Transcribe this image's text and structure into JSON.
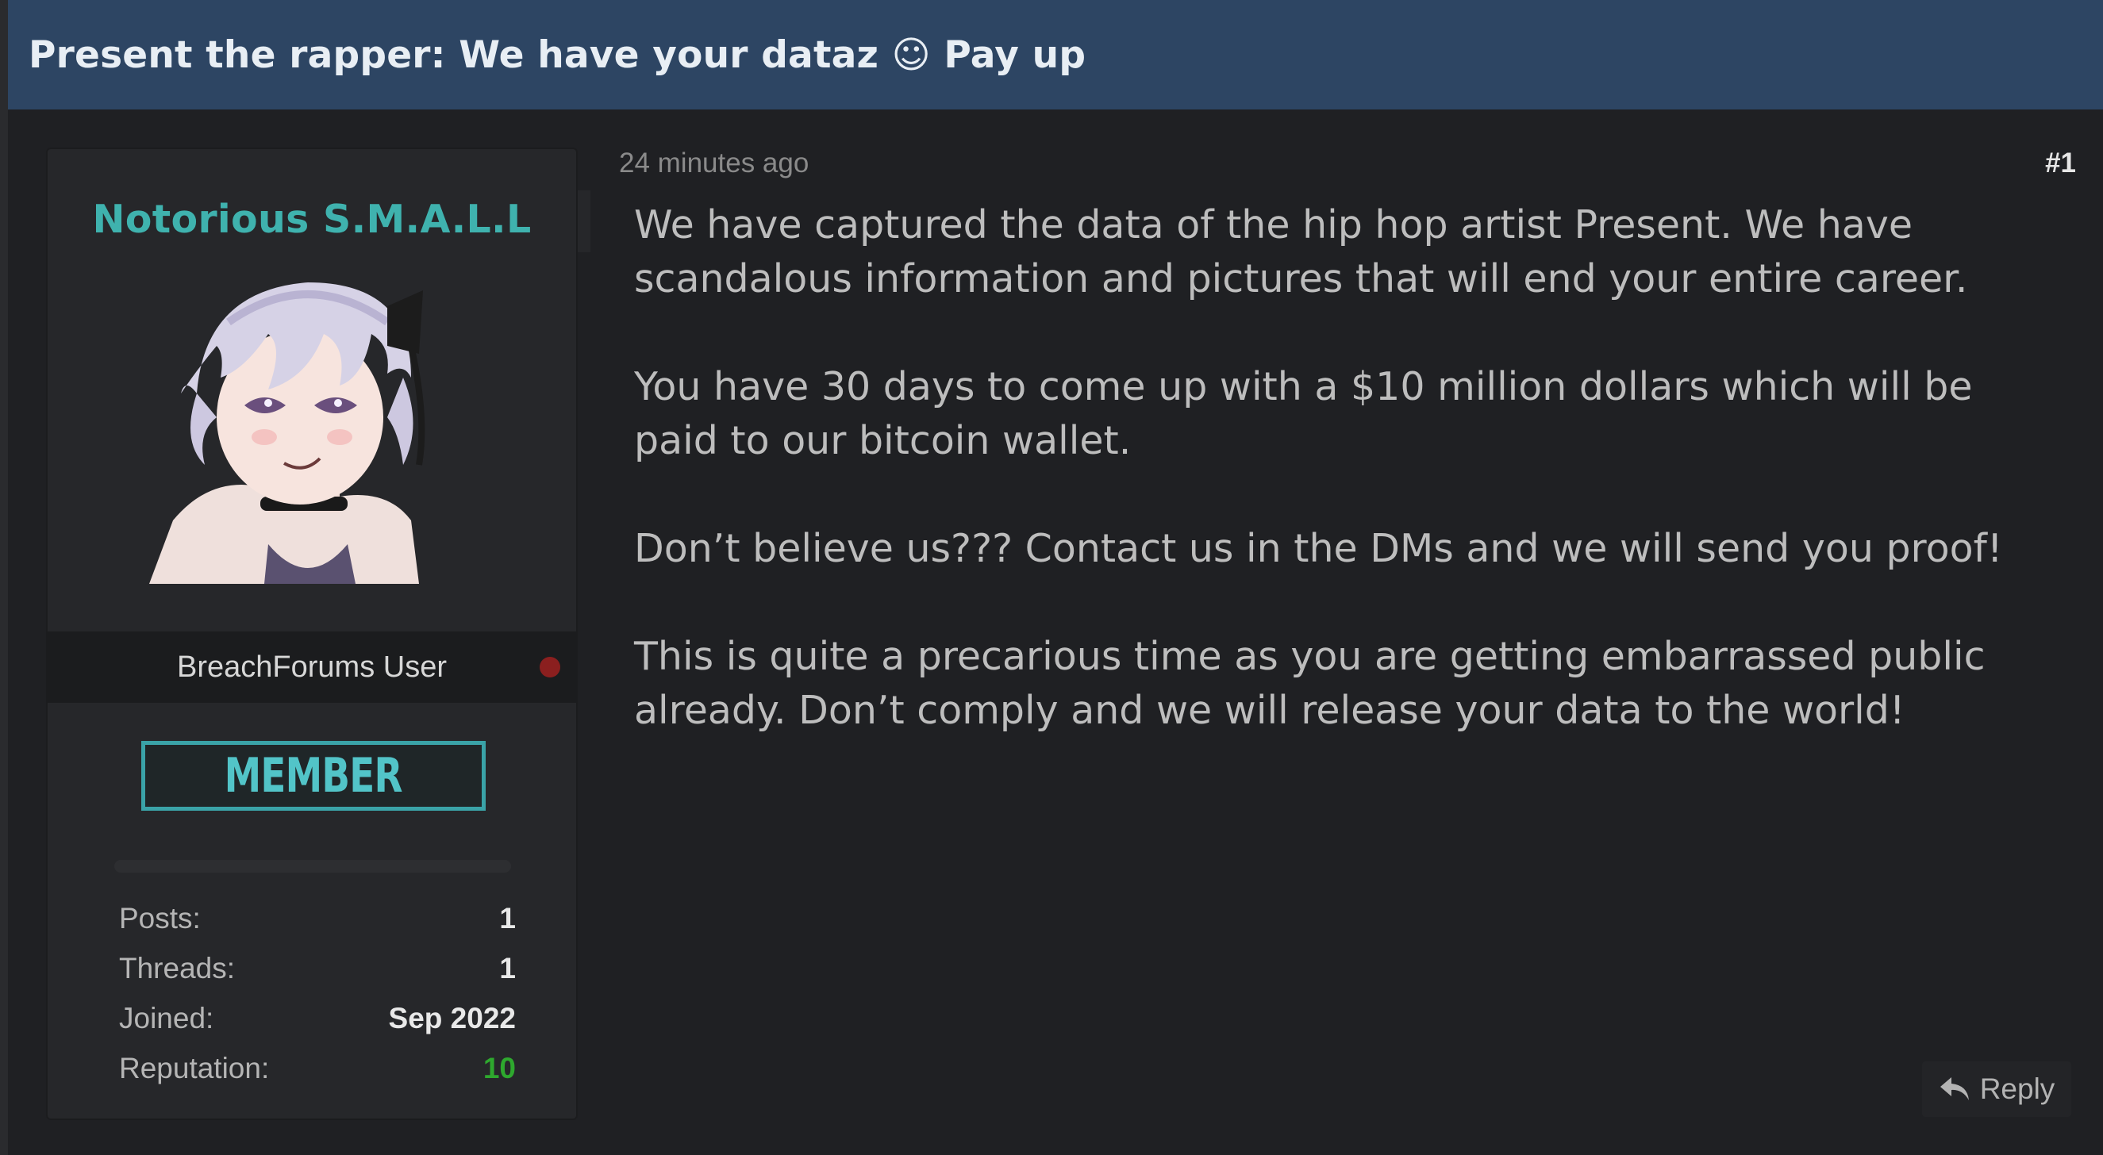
{
  "thread": {
    "title": "Present the rapper: We have your dataz ☺ Pay up"
  },
  "user": {
    "username": "Notorious S.M.A.L.L",
    "avatar_icon": "anime-avatar-icon",
    "usergroup": "BreachForums User",
    "status_color": "#8b1f1f",
    "rank": "MEMBER",
    "stats": [
      {
        "label": "Posts:",
        "value": "1"
      },
      {
        "label": "Threads:",
        "value": "1"
      },
      {
        "label": "Joined:",
        "value": "Sep 2022"
      },
      {
        "label": "Reputation:",
        "value": "10"
      }
    ]
  },
  "post": {
    "time": "24 minutes ago",
    "number": "#1",
    "paragraphs": [
      "We have captured the data of the hip hop artist Present. We have scandalous information and pictures that will end your entire career.",
      "You have 30 days to come up with a $10 million dollars which will be paid to our bitcoin wallet.",
      "Don’t believe us??? Contact us in the DMs and we will send you proof!",
      "This is quite a precarious time as you are getting embarrassed public already. Don’t comply and we will release your data to the world!"
    ],
    "reply_label": "Reply",
    "reply_icon": "reply-arrow-icon"
  },
  "colors": {
    "header_bg": "#2d4563",
    "username": "#3fb2ae",
    "rank": "#3aa3a8",
    "reputation": "#2ea82e"
  }
}
